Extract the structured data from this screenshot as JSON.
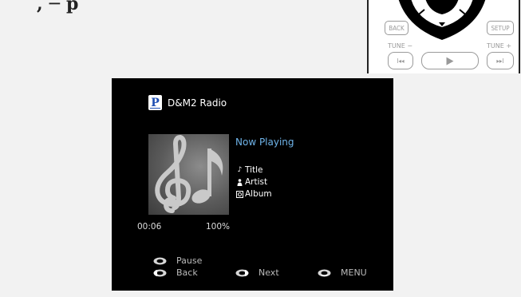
{
  "manual": {
    "heading_fragment": ", ─ p"
  },
  "remote": {
    "back_label": "BACK",
    "setup_label": "SETUP",
    "tune_minus_label": "TUNE −",
    "tune_plus_label": "TUNE +",
    "prev_glyph": "I◂◂",
    "play_glyph": "▶",
    "next_glyph": "▸▸I"
  },
  "screen": {
    "station_name": "D&M2 Radio",
    "logo_letter": "P",
    "now_playing": "Now Playing",
    "track": {
      "title": "Title",
      "artist": "Artist",
      "album": "Album"
    },
    "elapsed_time": "00:06",
    "buffer": "100%",
    "guide": {
      "pause": "Pause",
      "back": "Back",
      "next": "Next",
      "menu": "MENU"
    },
    "colors": {
      "now_playing": "#6fb4ea",
      "background": "#000000"
    }
  }
}
